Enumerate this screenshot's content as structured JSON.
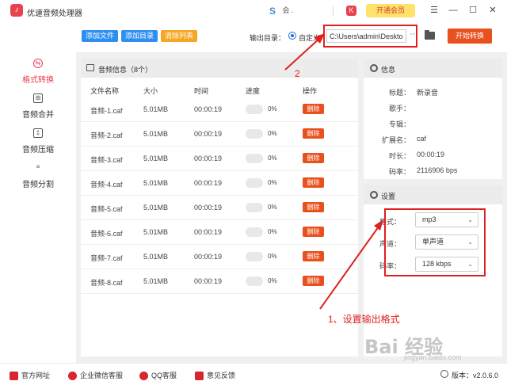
{
  "app": {
    "title": "优速音频处理器",
    "logo_glyph": "♪",
    "user_name": "会 .",
    "vip_label": "开通会员",
    "vip_logo": "K",
    "window_controls": [
      "menu-icon",
      "minimize-icon",
      "maximize-icon",
      "close-icon"
    ]
  },
  "sidebar": {
    "items": [
      {
        "label": "格式转换",
        "icon": "format-convert-icon",
        "glyph": "⇆",
        "active": true
      },
      {
        "label": "音频合并",
        "icon": "audio-merge-icon",
        "glyph": "⊞",
        "active": false
      },
      {
        "label": "音频压缩",
        "icon": "audio-compress-icon",
        "glyph": "‡",
        "active": false
      },
      {
        "label": "音频分割",
        "icon": "audio-split-icon",
        "glyph": "≡",
        "active": false
      }
    ]
  },
  "toolbar": {
    "add_file": "添加文件",
    "add_dir": "添加目录",
    "clear_list": "清除列表",
    "output_dir_label": "输出目录：",
    "custom_label": "自定义",
    "output_path": "C:\\Users\\admin\\Deskto",
    "more": "···",
    "start": "开始转换",
    "colors": {
      "blue": "#2f8ff0",
      "orange": "#f5a623",
      "red": "#e8501d"
    }
  },
  "file_panel": {
    "title": "音频信息（8个）",
    "columns": [
      "文件名称",
      "大小",
      "时间",
      "进度",
      "操作"
    ],
    "rows": [
      {
        "name": "音频-1.caf",
        "size": "5.01MB",
        "time": "00:00:19",
        "progress": "0%",
        "action": "删除"
      },
      {
        "name": "音频-2.caf",
        "size": "5.01MB",
        "time": "00:00:19",
        "progress": "0%",
        "action": "删除"
      },
      {
        "name": "音频-3.caf",
        "size": "5.01MB",
        "time": "00:00:19",
        "progress": "0%",
        "action": "删除"
      },
      {
        "name": "音频-4.caf",
        "size": "5.01MB",
        "time": "00:00:19",
        "progress": "0%",
        "action": "删除"
      },
      {
        "name": "音频-5.caf",
        "size": "5.01MB",
        "time": "00:00:19",
        "progress": "0%",
        "action": "删除"
      },
      {
        "name": "音频-6.caf",
        "size": "5.01MB",
        "time": "00:00:19",
        "progress": "0%",
        "action": "删除"
      },
      {
        "name": "音频-7.caf",
        "size": "5.01MB",
        "time": "00:00:19",
        "progress": "0%",
        "action": "删除"
      },
      {
        "name": "音频-8.caf",
        "size": "5.01MB",
        "time": "00:00:19",
        "progress": "0%",
        "action": "删除"
      }
    ]
  },
  "info_panel": {
    "title": "信息",
    "fields": [
      {
        "key": "标题：",
        "value": "新录音"
      },
      {
        "key": "歌手：",
        "value": ""
      },
      {
        "key": "专辑：",
        "value": ""
      },
      {
        "key": "扩展名：",
        "value": "caf"
      },
      {
        "key": "时长：",
        "value": "00:00:19"
      },
      {
        "key": "码率：",
        "value": "2116906 bps"
      }
    ]
  },
  "settings_panel": {
    "title": "设置",
    "format_label": "格式：",
    "format_value": "mp3",
    "channel_label": "声道：",
    "channel_value": "单声道",
    "bitrate_label": "码率：",
    "bitrate_value": "128 kbps"
  },
  "footer": {
    "website": "官方网址",
    "wechat": "企业微信客服",
    "qq": "QQ客服",
    "feedback": "意见反馈",
    "version": "版本：v2.0.6.0"
  },
  "annotations": {
    "label_1": "1、设置输出格式",
    "label_2": "2",
    "color": "#e02020"
  },
  "watermark": {
    "text": "Bai 经验",
    "sub": "jingyan.baidu.com"
  }
}
